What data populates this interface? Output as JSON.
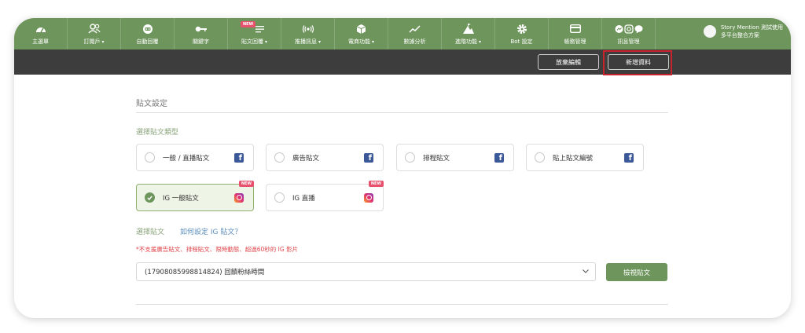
{
  "nav": {
    "items": [
      {
        "label": "主選單",
        "icon": "dashboard-icon",
        "caret": false,
        "new": false
      },
      {
        "label": "訂閱戶",
        "icon": "users-icon",
        "caret": true,
        "new": false
      },
      {
        "label": "自動回覆",
        "icon": "robot-icon",
        "caret": false,
        "new": false
      },
      {
        "label": "關鍵字",
        "icon": "key-icon",
        "caret": false,
        "new": false
      },
      {
        "label": "貼文回覆",
        "icon": "list-icon",
        "caret": true,
        "new": true
      },
      {
        "label": "推播訊息",
        "icon": "broadcast-icon",
        "caret": true,
        "new": false
      },
      {
        "label": "電商功能",
        "icon": "box-icon",
        "caret": true,
        "new": false
      },
      {
        "label": "數據分析",
        "icon": "chart-icon",
        "caret": false,
        "new": false
      },
      {
        "label": "進階功能",
        "icon": "mountain-icon",
        "caret": true,
        "new": false
      },
      {
        "label": "Bot 設定",
        "icon": "gear-icon",
        "caret": false,
        "new": false
      },
      {
        "label": "帳務管理",
        "icon": "card-icon",
        "caret": false,
        "new": false
      },
      {
        "label": "訊息管理",
        "icon": "messenger-icons",
        "caret": false,
        "new": false
      }
    ],
    "new_badge": "NEW",
    "caret_glyph": "▾",
    "user": {
      "line1": "Story Mention 測試使用",
      "line2": "多平台整合方案"
    }
  },
  "toolbar": {
    "discard_label": "放棄編輯",
    "add_label": "新增資料"
  },
  "form": {
    "section_title": "貼文設定",
    "type_title": "選擇貼文類型",
    "cards": [
      {
        "label": "一般 / 直播貼文",
        "platform": "facebook",
        "fb_glyph": "f",
        "selected": false
      },
      {
        "label": "廣告貼文",
        "platform": "facebook",
        "fb_glyph": "f",
        "selected": false
      },
      {
        "label": "排程貼文",
        "platform": "facebook",
        "fb_glyph": "f",
        "selected": false
      },
      {
        "label": "貼上貼文編號",
        "platform": "facebook",
        "fb_glyph": "f",
        "selected": false
      },
      {
        "label": "IG 一般貼文",
        "platform": "instagram",
        "new": true,
        "selected": true
      },
      {
        "label": "IG 直播",
        "platform": "instagram",
        "new": true,
        "selected": false
      }
    ],
    "card_new_badge": "NEW",
    "select_post_label": "選擇貼文",
    "help_link": "如何設定 IG 貼文？",
    "warning": "*不支援廣告貼文、排程貼文、限時動態、超過60秒的 IG 影片",
    "selected_post": "(17908085998814824) 回饋粉絲時間",
    "view_button": "檢視貼文"
  },
  "colors": {
    "brand_green": "#6e955c",
    "toolbar_dark": "#3d3d3d",
    "highlight_red": "#c8232c",
    "new_pink": "#e8516e",
    "facebook_blue": "#3b5998"
  }
}
